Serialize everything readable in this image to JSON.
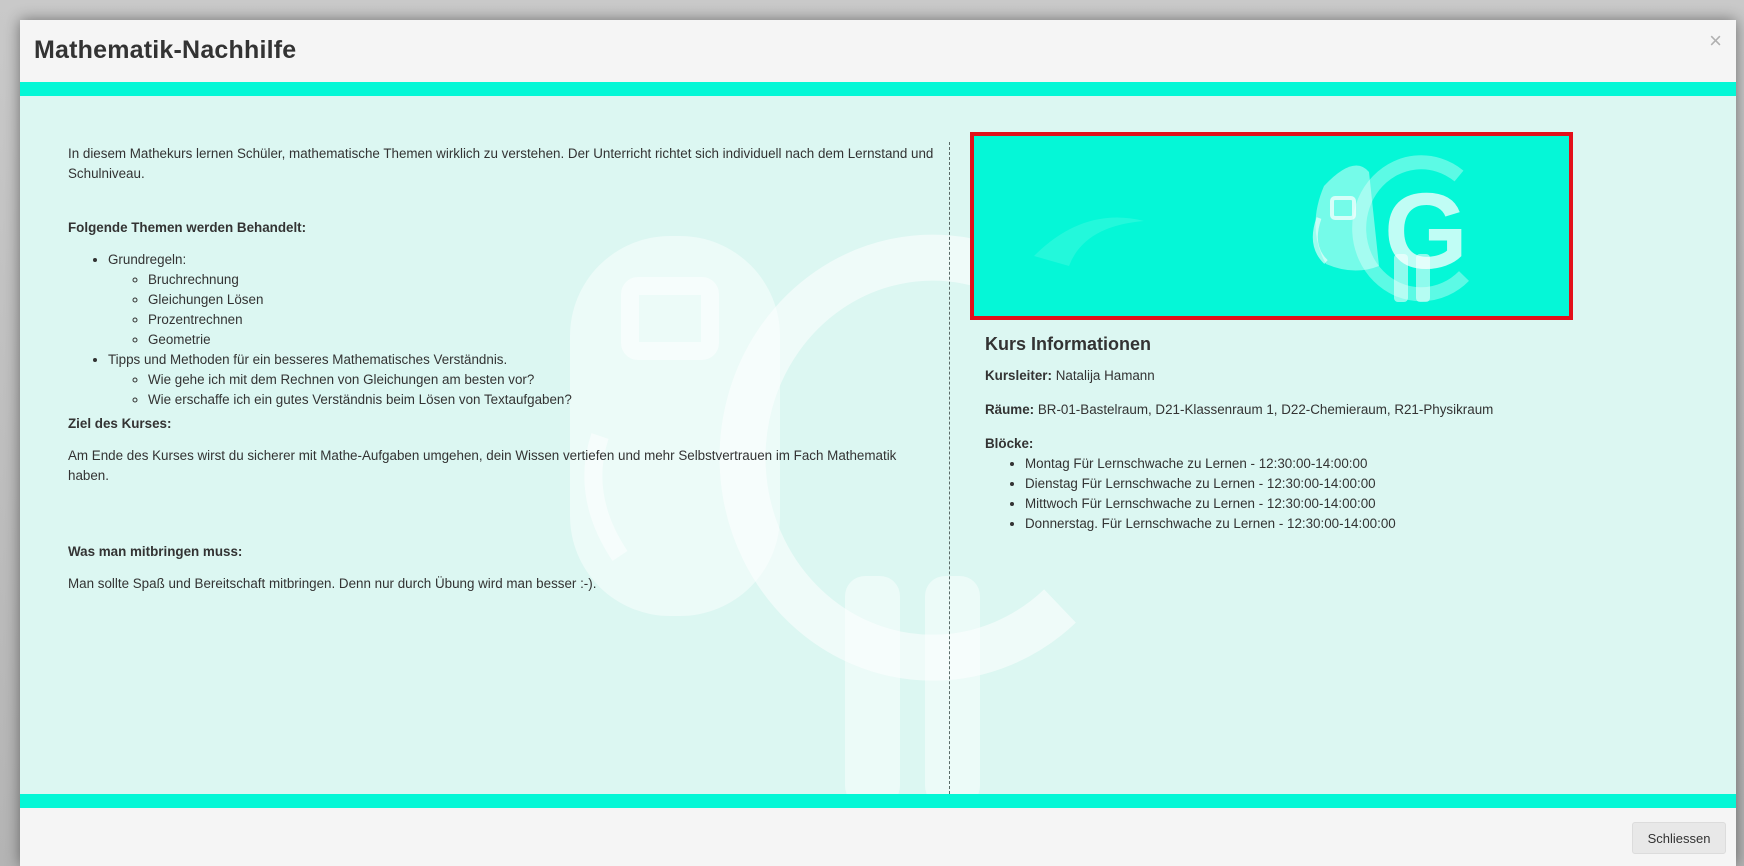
{
  "modal": {
    "title": "Mathematik-Nachhilfe",
    "close_symbol": "×"
  },
  "description": {
    "intro": "In diesem Mathekurs lernen Schüler, mathematische Themen wirklich zu verstehen. Der Unterricht richtet sich individuell nach dem Lernstand und Schulniveau.",
    "topics_heading": "Folgende Themen werden Behandelt:",
    "topics": [
      {
        "label": "Grundregeln:",
        "subitems": [
          "Bruchrechnung",
          "Gleichungen Lösen",
          "Prozentrechnen",
          "Geometrie"
        ]
      },
      {
        "label": "Tipps und Methoden für ein besseres Mathematisches Verständnis.",
        "subitems": [
          "Wie gehe ich mit dem Rechnen von Gleichungen am besten vor?",
          "Wie erschaffe ich ein gutes Verständnis beim Lösen von Textaufgaben?"
        ]
      }
    ],
    "goal_heading": "Ziel des Kurses:",
    "goal_text": "Am Ende des Kurses wirst du sicherer mit Mathe-Aufgaben umgehen, dein Wissen vertiefen und mehr Selbstvertrauen im Fach Mathematik haben.",
    "bring_heading": "Was man mitbringen muss:",
    "bring_text": "Man sollte Spaß und Bereitschaft mitbringen. Denn nur durch Übung wird man besser :-)."
  },
  "banner": {
    "logo_letter": "G",
    "logo_icon": "backpack-mascot-icon"
  },
  "course_info": {
    "heading": "Kurs Informationen",
    "leader_label": "Kursleiter:",
    "leader_value": " Natalija Hamann",
    "rooms_label": "Räume:",
    "rooms_value": " BR-01-Bastelraum, D21-Klassenraum 1, D22-Chemieraum, R21-Physikraum",
    "blocks_label": "Blöcke:",
    "blocks": [
      "Montag Für Lernschwache zu Lernen - 12:30:00-14:00:00",
      "Dienstag Für Lernschwache zu Lernen - 12:30:00-14:00:00",
      "Mittwoch Für Lernschwache zu Lernen - 12:30:00-14:00:00",
      "Donnerstag. Für Lernschwache zu Lernen - 12:30:00-14:00:00"
    ]
  },
  "footer": {
    "close_label": "Schliessen"
  },
  "colors": {
    "accent": "#04f7d6",
    "body_bg": "#dcf7f2",
    "highlight_border": "#e3101a"
  }
}
